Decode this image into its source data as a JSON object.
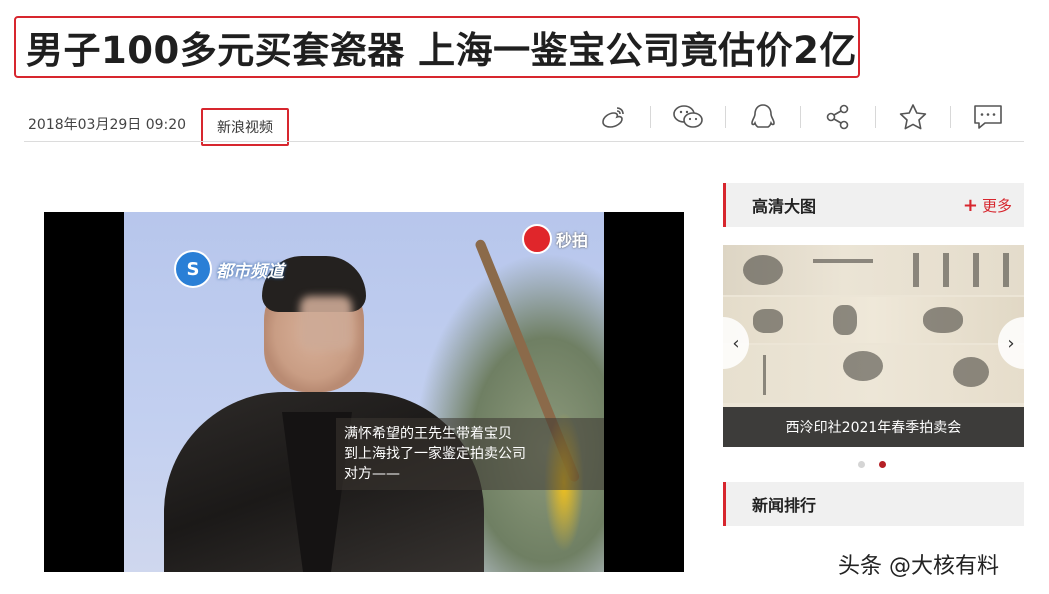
{
  "article": {
    "title": "男子100多元买套瓷器 上海一鉴宝公司竟估价2亿",
    "date": "2018年03月29日 09:20",
    "source": "新浪视频"
  },
  "share_icons": [
    "weibo-icon",
    "wechat-icon",
    "qq-icon",
    "share-icon",
    "star-icon",
    "comment-icon"
  ],
  "video": {
    "channel_logo": "都市频道",
    "corner_logo": "秒拍",
    "subtitle_line1": "满怀希望的王先生带着宝贝",
    "subtitle_line2": "到上海找了一家鉴定拍卖公司",
    "subtitle_line3": "对方——"
  },
  "sidebar": {
    "hd_pictures": {
      "label": "高清大图",
      "more": "更多",
      "caption": "西泠印社2021年春季拍卖会",
      "slide_count": 2,
      "active_slide": 2
    },
    "news_ranking": {
      "label": "新闻排行"
    }
  },
  "watermark": "头条 @大核有料",
  "colors": {
    "accent": "#d7262e",
    "active_dot": "#b51f25"
  }
}
